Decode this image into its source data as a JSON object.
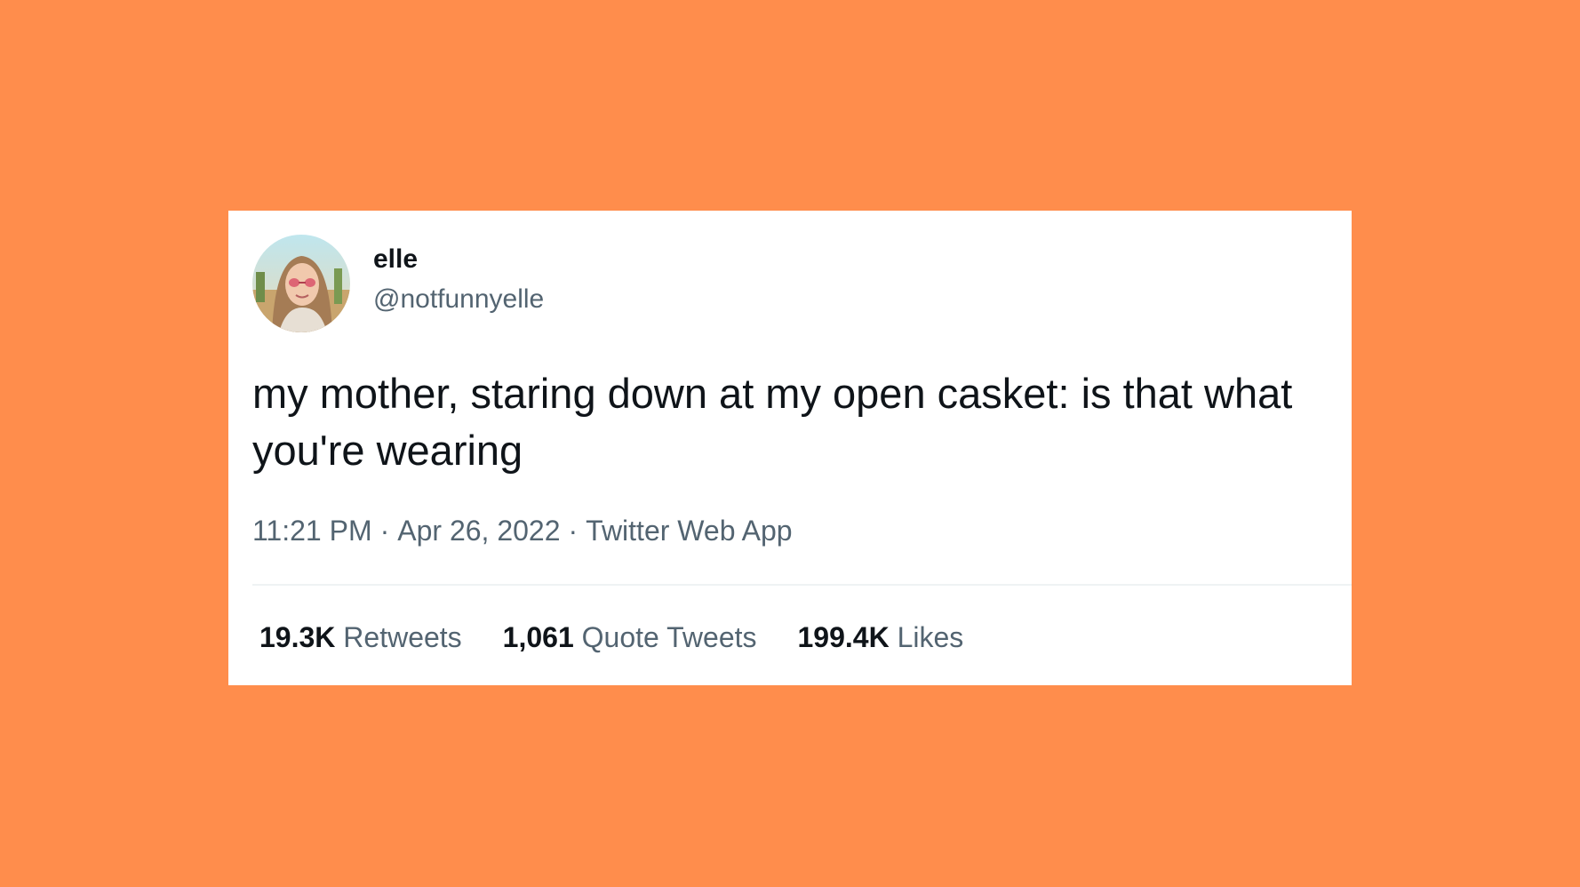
{
  "colors": {
    "background": "#FF8D4C",
    "card": "#ffffff",
    "primary_text": "#0f1419",
    "secondary_text": "#536471"
  },
  "tweet": {
    "avatar_icon": "profile-photo",
    "display_name": "elle",
    "handle": "@notfunnyelle",
    "text": "my mother, staring down at my open casket: is that what you're wearing",
    "time": "11:21 PM",
    "date": "Apr 26, 2022",
    "source": "Twitter Web App",
    "separator": "·",
    "stats": {
      "retweets_count": "19.3K",
      "retweets_label": "Retweets",
      "quotes_count": "1,061",
      "quotes_label": "Quote Tweets",
      "likes_count": "199.4K",
      "likes_label": "Likes"
    }
  }
}
